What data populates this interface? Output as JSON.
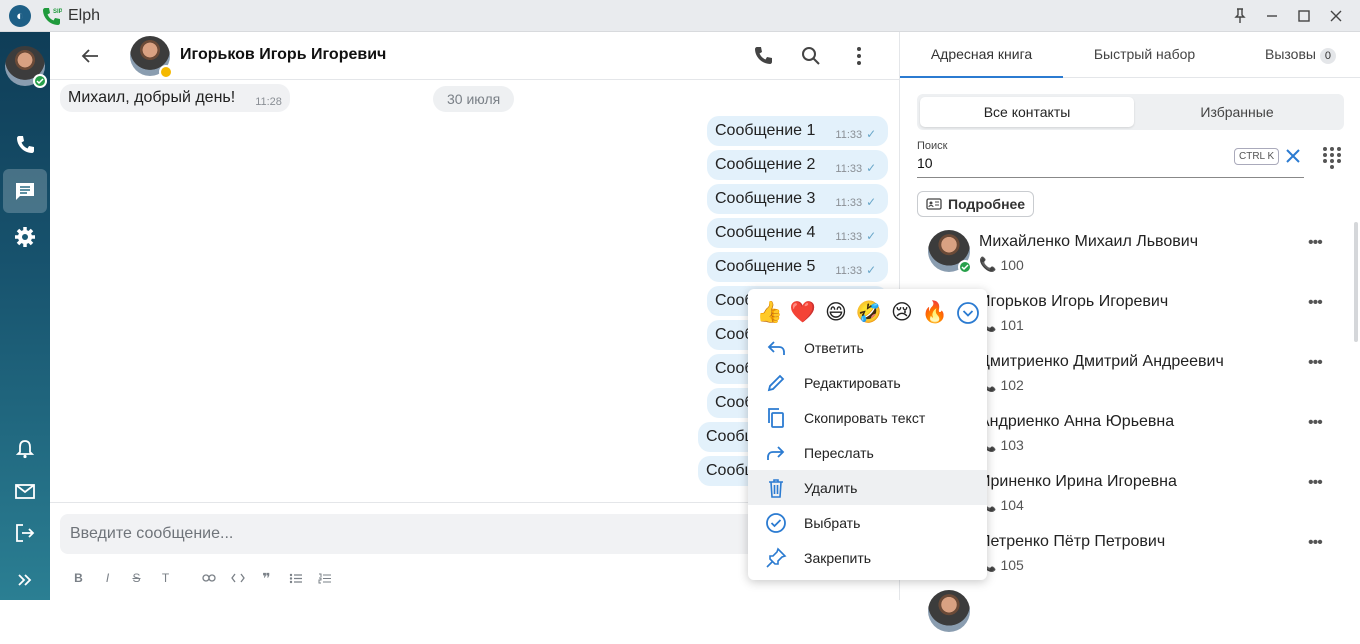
{
  "window": {
    "title": "Elph"
  },
  "chat": {
    "contact_name": "Игорьков Игорь Игоревич",
    "date_chip": "30 июля",
    "incoming": {
      "text": "Михаил, добрый день!",
      "time": "11:28"
    },
    "outgoing": [
      {
        "text": "Сообщение 1",
        "time": "11:33"
      },
      {
        "text": "Сообщение 2",
        "time": "11:33"
      },
      {
        "text": "Сообщение 3",
        "time": "11:33"
      },
      {
        "text": "Сообщение 4",
        "time": "11:33"
      },
      {
        "text": "Сообщение 5",
        "time": "11:33"
      },
      {
        "text": "Сообщ"
      },
      {
        "text": "Сообщ"
      },
      {
        "text": "Сообщ"
      },
      {
        "text": "Сообщ"
      },
      {
        "text": "Сообщ"
      },
      {
        "text": "Сообщ"
      }
    ]
  },
  "composer": {
    "placeholder": "Введите сообщение...",
    "format_buttons": [
      "B",
      "I",
      "S",
      "T",
      "link",
      "code",
      "quote",
      "bulleted-list",
      "numbered-list"
    ]
  },
  "context_menu": {
    "emojis": [
      "👍",
      "❤️",
      "😄",
      "🤣",
      "😢",
      "🔥"
    ],
    "items": [
      {
        "label": "Ответить",
        "icon": "reply-icon"
      },
      {
        "label": "Редактировать",
        "icon": "pencil-icon"
      },
      {
        "label": "Скопировать текст",
        "icon": "copy-icon"
      },
      {
        "label": "Переслать",
        "icon": "forward-icon"
      },
      {
        "label": "Удалить",
        "icon": "trash-icon"
      },
      {
        "label": "Выбрать",
        "icon": "check-circle-icon"
      },
      {
        "label": "Закрепить",
        "icon": "pin-icon"
      }
    ]
  },
  "right_panel": {
    "tabs": [
      {
        "label": "Адресная книга"
      },
      {
        "label": "Быстрый набор"
      },
      {
        "label": "Вызовы",
        "badge": "0"
      }
    ],
    "segments": [
      "Все контакты",
      "Избранные"
    ],
    "search": {
      "label": "Поиск",
      "value": "10",
      "shortcut": "CTRL K"
    },
    "details_button": "Подробнее",
    "contacts": [
      {
        "name": "Михайленко Михаил Львович",
        "number": "100"
      },
      {
        "name": "Игорьков Игорь Игоревич",
        "number": "101"
      },
      {
        "name": "Дмитриенко Дмитрий Андреевич",
        "number": "102"
      },
      {
        "name": "Андриенко Анна Юрьевна",
        "number": "103"
      },
      {
        "name": "Ириненко Ирина Игоревна",
        "number": "104"
      },
      {
        "name": "Петренко Пётр Петрович",
        "number": "105"
      }
    ]
  },
  "colors": {
    "accent": "#2b7bd1",
    "outgoing_bubble": "#e3f1fb",
    "online": "#27a04a",
    "away": "#f5b900"
  }
}
